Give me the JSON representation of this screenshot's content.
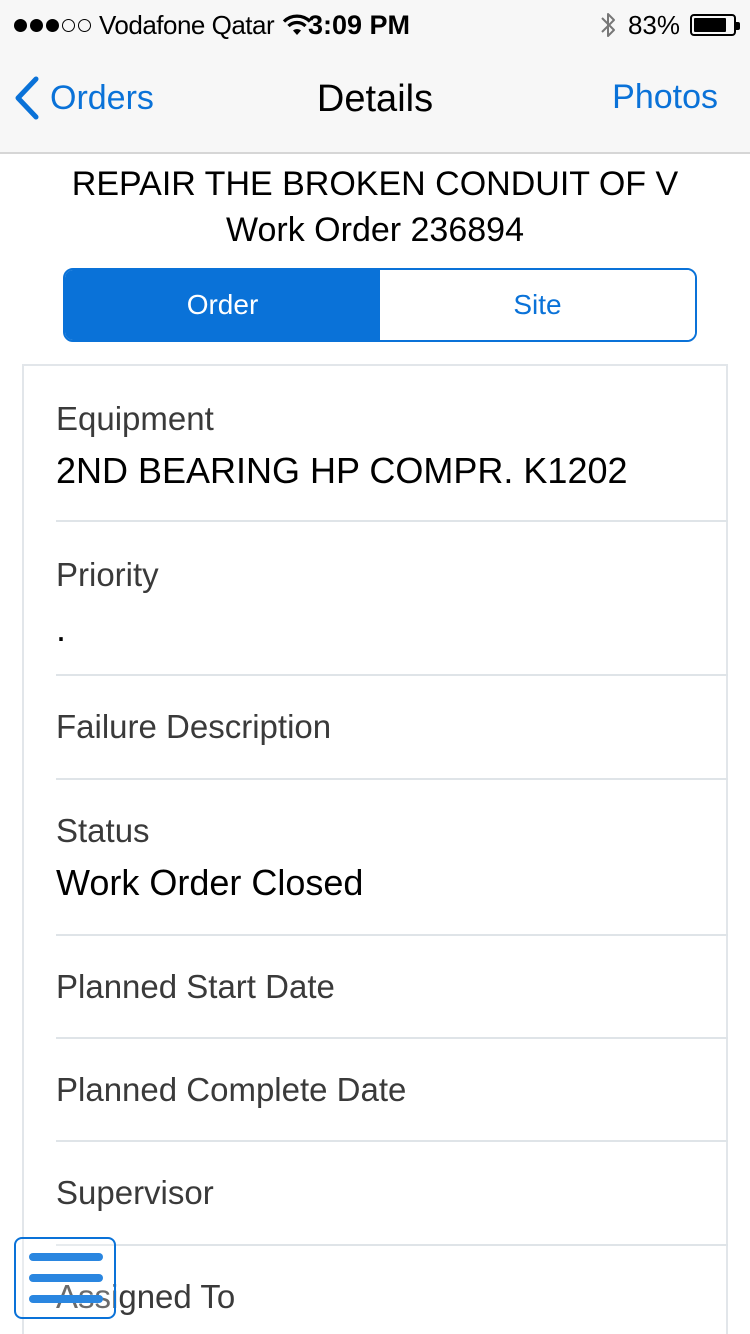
{
  "status_bar": {
    "carrier": "Vodafone Qatar",
    "time": "3:09 PM",
    "battery_percent": "83%",
    "signal_bars_filled": 3,
    "signal_bars_total": 5,
    "battery_level": 0.83
  },
  "nav": {
    "back_label": "Orders",
    "title": "Details",
    "right_label": "Photos"
  },
  "header": {
    "title": "REPAIR THE BROKEN CONDUIT OF V",
    "subtitle": "Work Order 236894"
  },
  "tabs": [
    {
      "label": "Order",
      "active": true
    },
    {
      "label": "Site",
      "active": false
    }
  ],
  "fields": [
    {
      "label": "Equipment",
      "value": "2ND BEARING HP COMPR. K1202"
    },
    {
      "label": "Priority",
      "value": "."
    },
    {
      "label": "Failure Description",
      "value": ""
    },
    {
      "label": "Status",
      "value": "Work Order Closed"
    },
    {
      "label": "Planned Start Date",
      "value": ""
    },
    {
      "label": "Planned Complete Date",
      "value": ""
    },
    {
      "label": "Supervisor",
      "value": ""
    },
    {
      "label": "Assigned To",
      "value": ""
    }
  ],
  "colors": {
    "accent": "#0a72d8",
    "bar_background": "#f7f7f7",
    "divider": "#dfe4e8"
  },
  "icons": {
    "back": "chevron-left-icon",
    "wifi": "wifi-icon",
    "bluetooth": "bluetooth-icon",
    "battery": "battery-icon",
    "menu": "hamburger-menu-icon"
  }
}
